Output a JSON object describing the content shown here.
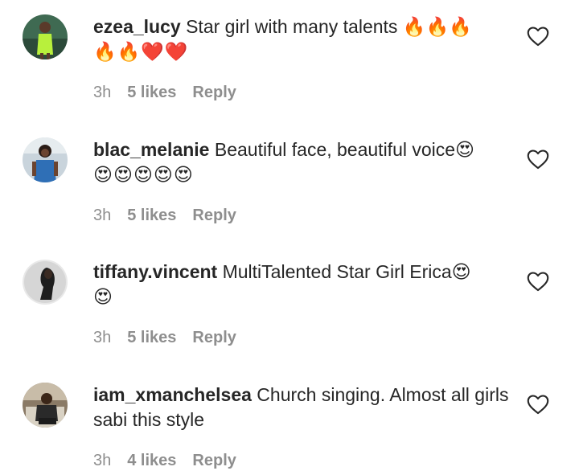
{
  "comments": [
    {
      "username": "ezea_lucy",
      "text": "Star girl with many talents",
      "emoji_inline": "🔥🔥🔥",
      "emoji_line": "🔥🔥❤️❤️",
      "time": "3h",
      "likes": "5 likes",
      "reply": "Reply"
    },
    {
      "username": "blac_melanie",
      "text": "Beautiful face, beautiful voice😍",
      "emoji_inline": "",
      "emoji_line": "😍😍😍😍😍",
      "time": "3h",
      "likes": "5 likes",
      "reply": "Reply"
    },
    {
      "username": "tiffany.vincent",
      "text": "MultiTalented Star Girl Erica😍",
      "emoji_inline": "",
      "emoji_line": "😍",
      "time": "3h",
      "likes": "5 likes",
      "reply": "Reply"
    },
    {
      "username": "iam_xmanchelsea",
      "text": "Church singing. Almost all girls sabi this style",
      "emoji_inline": "",
      "emoji_line": "",
      "time": "3h",
      "likes": "4 likes",
      "reply": "Reply"
    }
  ],
  "colors": {
    "text": "#262626",
    "meta": "#8e8e8e",
    "background": "#ffffff"
  }
}
